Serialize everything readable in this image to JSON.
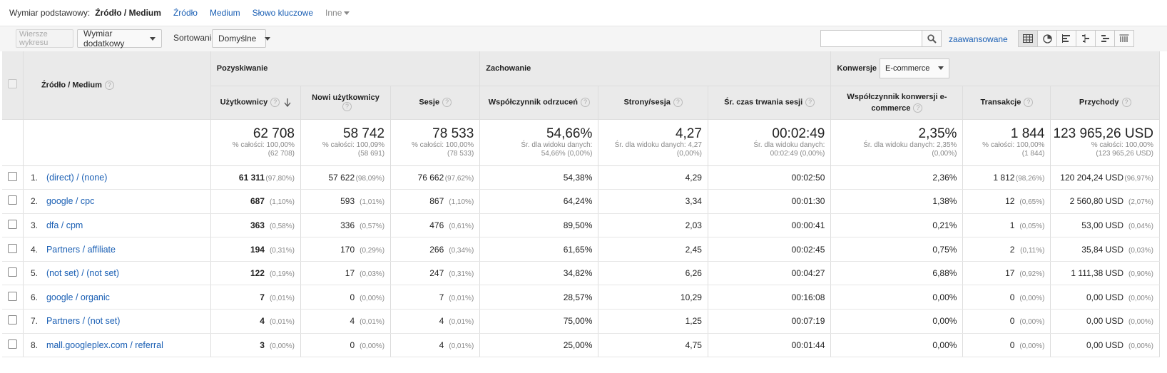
{
  "dim": {
    "label": "Wymiar podstawowy:",
    "active": "Źródło / Medium",
    "links": [
      "Źródło",
      "Medium",
      "Słowo kluczowe"
    ],
    "more": "Inne"
  },
  "toolbar": {
    "plot_rows": "Wiersze wykresu",
    "secondary": "Wymiar dodatkowy",
    "sort_label": "Sortowanie:",
    "sort_value": "Domyślne",
    "search_value": "",
    "advanced": "zaawansowane",
    "views": [
      "table-view-icon",
      "pie-view-icon",
      "performance-view-icon",
      "comparison-view-icon",
      "term-cloud-icon",
      "pivot-view-icon"
    ]
  },
  "table": {
    "dim_header": "Źródło / Medium",
    "groups": {
      "acquisition": "Pozyskiwanie",
      "behavior": "Zachowanie",
      "conversions": "Konwersje",
      "conv_select": "E-commerce"
    },
    "columns": [
      "Użytkownicy",
      "Nowi użytkownicy",
      "Sesje",
      "Współczynnik odrzuceń",
      "Strony/sesja",
      "Śr. czas trwania sesji",
      "Współczynnik konwersji e-commerce",
      "Transakcje",
      "Przychody"
    ],
    "totals": [
      {
        "value": "62 708",
        "sub1": "% całości: 100,00%",
        "sub2": "(62 708)"
      },
      {
        "value": "58 742",
        "sub1": "% całości: 100,09%",
        "sub2": "(58 691)"
      },
      {
        "value": "78 533",
        "sub1": "% całości: 100,00%",
        "sub2": "(78 533)"
      },
      {
        "value": "54,66%",
        "sub1": "Śr. dla widoku danych:",
        "sub2": "54,66% (0,00%)"
      },
      {
        "value": "4,27",
        "sub1": "Śr. dla widoku danych: 4,27",
        "sub2": "(0,00%)"
      },
      {
        "value": "00:02:49",
        "sub1": "Śr. dla widoku danych:",
        "sub2": "00:02:49 (0,00%)"
      },
      {
        "value": "2,35%",
        "sub1": "Śr. dla widoku danych: 2,35%",
        "sub2": "(0,00%)"
      },
      {
        "value": "1 844",
        "sub1": "% całości: 100,00%",
        "sub2": "(1 844)"
      },
      {
        "value": "123 965,26 USD",
        "sub1": "% całości: 100,00%",
        "sub2": "(123 965,26 USD)"
      }
    ],
    "rows": [
      {
        "n": "1.",
        "src": "(direct) / (none)",
        "users": "61 311",
        "users_p": "(97,80%)",
        "new": "57 622",
        "new_p": "(98,09%)",
        "sess": "76 662",
        "sess_p": "(97,62%)",
        "bounce": "54,38%",
        "pps": "4,29",
        "dur": "00:02:50",
        "conv": "2,36%",
        "tr": "1 812",
        "tr_p": "(98,26%)",
        "rev": "120 204,24 USD",
        "rev_p": "(96,97%)"
      },
      {
        "n": "2.",
        "src": "google / cpc",
        "users": "687",
        "users_p": "(1,10%)",
        "new": "593",
        "new_p": "(1,01%)",
        "sess": "867",
        "sess_p": "(1,10%)",
        "bounce": "64,24%",
        "pps": "3,34",
        "dur": "00:01:30",
        "conv": "1,38%",
        "tr": "12",
        "tr_p": "(0,65%)",
        "rev": "2 560,80 USD",
        "rev_p": "(2,07%)"
      },
      {
        "n": "3.",
        "src": "dfa / cpm",
        "users": "363",
        "users_p": "(0,58%)",
        "new": "336",
        "new_p": "(0,57%)",
        "sess": "476",
        "sess_p": "(0,61%)",
        "bounce": "89,50%",
        "pps": "2,03",
        "dur": "00:00:41",
        "conv": "0,21%",
        "tr": "1",
        "tr_p": "(0,05%)",
        "rev": "53,00 USD",
        "rev_p": "(0,04%)"
      },
      {
        "n": "4.",
        "src": "Partners / affiliate",
        "users": "194",
        "users_p": "(0,31%)",
        "new": "170",
        "new_p": "(0,29%)",
        "sess": "266",
        "sess_p": "(0,34%)",
        "bounce": "61,65%",
        "pps": "2,45",
        "dur": "00:02:45",
        "conv": "0,75%",
        "tr": "2",
        "tr_p": "(0,11%)",
        "rev": "35,84 USD",
        "rev_p": "(0,03%)"
      },
      {
        "n": "5.",
        "src": "(not set) / (not set)",
        "users": "122",
        "users_p": "(0,19%)",
        "new": "17",
        "new_p": "(0,03%)",
        "sess": "247",
        "sess_p": "(0,31%)",
        "bounce": "34,82%",
        "pps": "6,26",
        "dur": "00:04:27",
        "conv": "6,88%",
        "tr": "17",
        "tr_p": "(0,92%)",
        "rev": "1 111,38 USD",
        "rev_p": "(0,90%)"
      },
      {
        "n": "6.",
        "src": "google / organic",
        "users": "7",
        "users_p": "(0,01%)",
        "new": "0",
        "new_p": "(0,00%)",
        "sess": "7",
        "sess_p": "(0,01%)",
        "bounce": "28,57%",
        "pps": "10,29",
        "dur": "00:16:08",
        "conv": "0,00%",
        "tr": "0",
        "tr_p": "(0,00%)",
        "rev": "0,00 USD",
        "rev_p": "(0,00%)"
      },
      {
        "n": "7.",
        "src": "Partners / (not set)",
        "users": "4",
        "users_p": "(0,01%)",
        "new": "4",
        "new_p": "(0,01%)",
        "sess": "4",
        "sess_p": "(0,01%)",
        "bounce": "75,00%",
        "pps": "1,25",
        "dur": "00:07:19",
        "conv": "0,00%",
        "tr": "0",
        "tr_p": "(0,00%)",
        "rev": "0,00 USD",
        "rev_p": "(0,00%)"
      },
      {
        "n": "8.",
        "src": "mall.googleplex.com / referral",
        "users": "3",
        "users_p": "(0,00%)",
        "new": "0",
        "new_p": "(0,00%)",
        "sess": "4",
        "sess_p": "(0,01%)",
        "bounce": "25,00%",
        "pps": "4,75",
        "dur": "00:01:44",
        "conv": "0,00%",
        "tr": "0",
        "tr_p": "(0,00%)",
        "rev": "0,00 USD",
        "rev_p": "(0,00%)"
      }
    ]
  }
}
